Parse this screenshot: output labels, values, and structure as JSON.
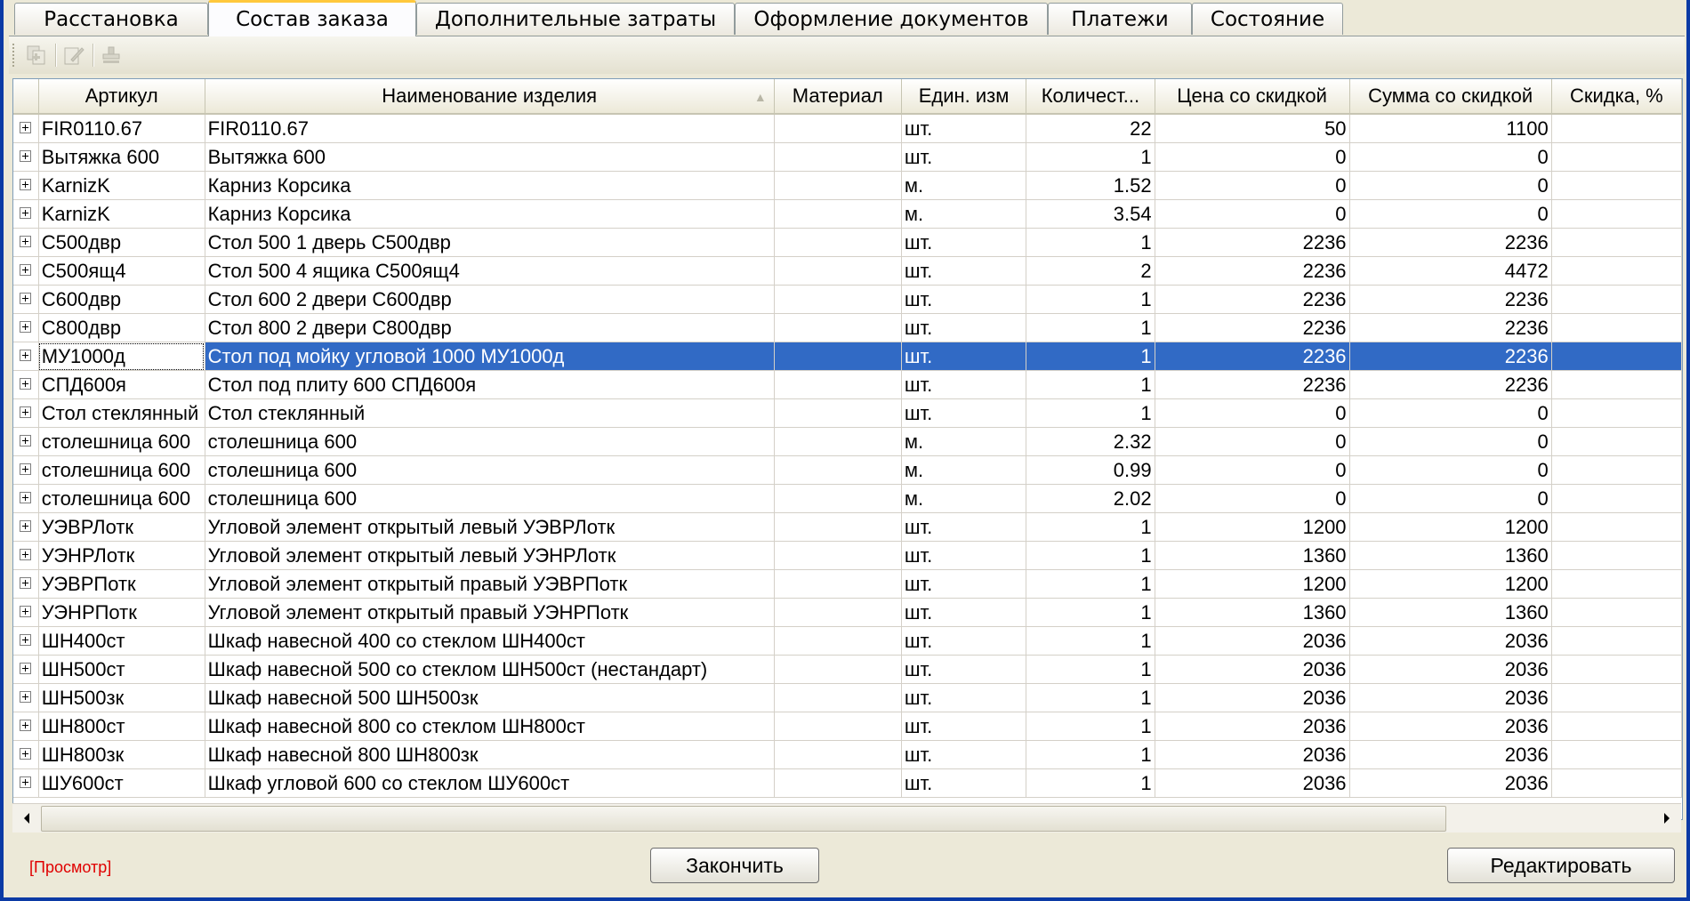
{
  "tabs": [
    {
      "label": "Расстановка",
      "active": false
    },
    {
      "label": "Состав заказа",
      "active": true
    },
    {
      "label": "Дополнительные затраты",
      "active": false
    },
    {
      "label": "Оформление документов",
      "active": false
    },
    {
      "label": "Платежи",
      "active": false
    },
    {
      "label": "Состояние",
      "active": false
    }
  ],
  "toolbar": {
    "buttons": [
      {
        "icon": "copy-icon",
        "enabled": false
      },
      {
        "icon": "edit-icon",
        "enabled": false
      },
      {
        "icon": "stamp-icon",
        "enabled": false
      }
    ]
  },
  "table": {
    "columns": [
      "Артикул",
      "Наименование изделия",
      "Материал",
      "Един. изм",
      "Количест...",
      "Цена со скидкой",
      "Сумма со скидкой",
      "Скидка, %"
    ],
    "selected_index": 8,
    "rows": [
      {
        "article": "FIR0110.67",
        "name": "FIR0110.67",
        "material": "",
        "unit": "шт.",
        "qty": "22",
        "price": "50",
        "sum": "1100",
        "discount": ""
      },
      {
        "article": "Вытяжка 600",
        "name": "Вытяжка 600",
        "material": "",
        "unit": "шт.",
        "qty": "1",
        "price": "0",
        "sum": "0",
        "discount": ""
      },
      {
        "article": "KarnizK",
        "name": "Карниз Корсика",
        "material": "",
        "unit": "м.",
        "qty": "1.52",
        "price": "0",
        "sum": "0",
        "discount": ""
      },
      {
        "article": "KarnizK",
        "name": "Карниз Корсика",
        "material": "",
        "unit": "м.",
        "qty": "3.54",
        "price": "0",
        "sum": "0",
        "discount": ""
      },
      {
        "article": "С500двр",
        "name": "Стол 500 1 дверь С500двр",
        "material": "",
        "unit": "шт.",
        "qty": "1",
        "price": "2236",
        "sum": "2236",
        "discount": ""
      },
      {
        "article": "С500ящ4",
        "name": "Стол 500 4 ящика С500ящ4",
        "material": "",
        "unit": "шт.",
        "qty": "2",
        "price": "2236",
        "sum": "4472",
        "discount": ""
      },
      {
        "article": "С600двр",
        "name": "Стол 600 2 двери С600двр",
        "material": "",
        "unit": "шт.",
        "qty": "1",
        "price": "2236",
        "sum": "2236",
        "discount": ""
      },
      {
        "article": "С800двр",
        "name": "Стол 800 2 двери С800двр",
        "material": "",
        "unit": "шт.",
        "qty": "1",
        "price": "2236",
        "sum": "2236",
        "discount": ""
      },
      {
        "article": "МУ1000д",
        "name": "Стол под мойку угловой 1000 МУ1000д",
        "material": "",
        "unit": "шт.",
        "qty": "1",
        "price": "2236",
        "sum": "2236",
        "discount": ""
      },
      {
        "article": "СПД600я",
        "name": "Стол под плиту 600 СПД600я",
        "material": "",
        "unit": "шт.",
        "qty": "1",
        "price": "2236",
        "sum": "2236",
        "discount": ""
      },
      {
        "article": "Стол стеклянный",
        "name": "Стол стеклянный",
        "material": "",
        "unit": "шт.",
        "qty": "1",
        "price": "0",
        "sum": "0",
        "discount": ""
      },
      {
        "article": "столешница 600",
        "name": "столешница 600",
        "material": "",
        "unit": "м.",
        "qty": "2.32",
        "price": "0",
        "sum": "0",
        "discount": ""
      },
      {
        "article": "столешница 600",
        "name": "столешница 600",
        "material": "",
        "unit": "м.",
        "qty": "0.99",
        "price": "0",
        "sum": "0",
        "discount": ""
      },
      {
        "article": "столешница 600",
        "name": "столешница 600",
        "material": "",
        "unit": "м.",
        "qty": "2.02",
        "price": "0",
        "sum": "0",
        "discount": ""
      },
      {
        "article": "УЭВРЛотк",
        "name": "Угловой элемент открытый левый УЭВРЛотк",
        "material": "",
        "unit": "шт.",
        "qty": "1",
        "price": "1200",
        "sum": "1200",
        "discount": ""
      },
      {
        "article": "УЭНРЛотк",
        "name": "Угловой элемент открытый левый УЭНРЛотк",
        "material": "",
        "unit": "шт.",
        "qty": "1",
        "price": "1360",
        "sum": "1360",
        "discount": ""
      },
      {
        "article": "УЭВРПотк",
        "name": "Угловой элемент открытый правый УЭВРПотк",
        "material": "",
        "unit": "шт.",
        "qty": "1",
        "price": "1200",
        "sum": "1200",
        "discount": ""
      },
      {
        "article": "УЭНРПотк",
        "name": "Угловой элемент открытый правый УЭНРПотк",
        "material": "",
        "unit": "шт.",
        "qty": "1",
        "price": "1360",
        "sum": "1360",
        "discount": ""
      },
      {
        "article": "ШН400ст",
        "name": "Шкаф навесной 400 со стеклом ШН400ст",
        "material": "",
        "unit": "шт.",
        "qty": "1",
        "price": "2036",
        "sum": "2036",
        "discount": ""
      },
      {
        "article": "ШН500ст",
        "name": "Шкаф навесной 500 со стеклом ШН500ст (нестандарт)",
        "material": "",
        "unit": "шт.",
        "qty": "1",
        "price": "2036",
        "sum": "2036",
        "discount": ""
      },
      {
        "article": "ШН500зк",
        "name": "Шкаф навесной 500 ШН500зк",
        "material": "",
        "unit": "шт.",
        "qty": "1",
        "price": "2036",
        "sum": "2036",
        "discount": ""
      },
      {
        "article": "ШН800ст",
        "name": "Шкаф навесной 800 со стеклом ШН800ст",
        "material": "",
        "unit": "шт.",
        "qty": "1",
        "price": "2036",
        "sum": "2036",
        "discount": ""
      },
      {
        "article": "ШН800зк",
        "name": "Шкаф навесной 800 ШН800зк",
        "material": "",
        "unit": "шт.",
        "qty": "1",
        "price": "2036",
        "sum": "2036",
        "discount": ""
      },
      {
        "article": "ШУ600ст",
        "name": "Шкаф угловой 600 со стеклом ШУ600ст",
        "material": "",
        "unit": "шт.",
        "qty": "1",
        "price": "2036",
        "sum": "2036",
        "discount": ""
      }
    ]
  },
  "footer": {
    "status": "[Просмотр]",
    "finish_label": "Закончить",
    "edit_label": "Редактировать"
  }
}
